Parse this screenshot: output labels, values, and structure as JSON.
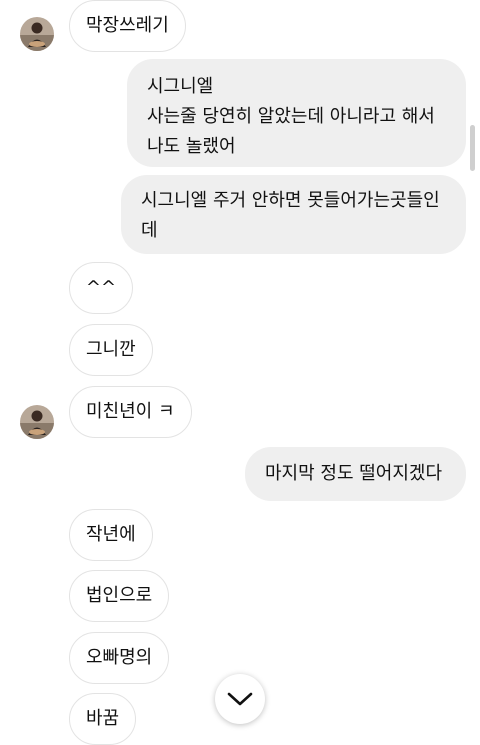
{
  "messages": {
    "m1": "막장쓰레기",
    "m2_line1": "시그니엘",
    "m2_line2": "사는줄 당연히 알았는데 아니라고 해서",
    "m2_line3": "나도 놀랬어",
    "m3_line1": "시그니엘 주거 안하면 못들어가는곳들인",
    "m3_line2": "데",
    "m4": "^^",
    "m5": "그니깐",
    "m6": "미친년이 ㅋ",
    "m7": "마지막 정도 떨어지겠다",
    "m8": "작년에",
    "m9": "법인으로",
    "m10": "오빠명의",
    "m11": "바꿈"
  },
  "icons": {
    "avatar": "profile-photo",
    "scroll_down": "chevron-down-icon"
  },
  "colors": {
    "incoming_bubble_bg": "#ffffff",
    "incoming_bubble_border": "#e3e3e3",
    "outgoing_bubble_bg": "#efefef",
    "text": "#111111"
  }
}
